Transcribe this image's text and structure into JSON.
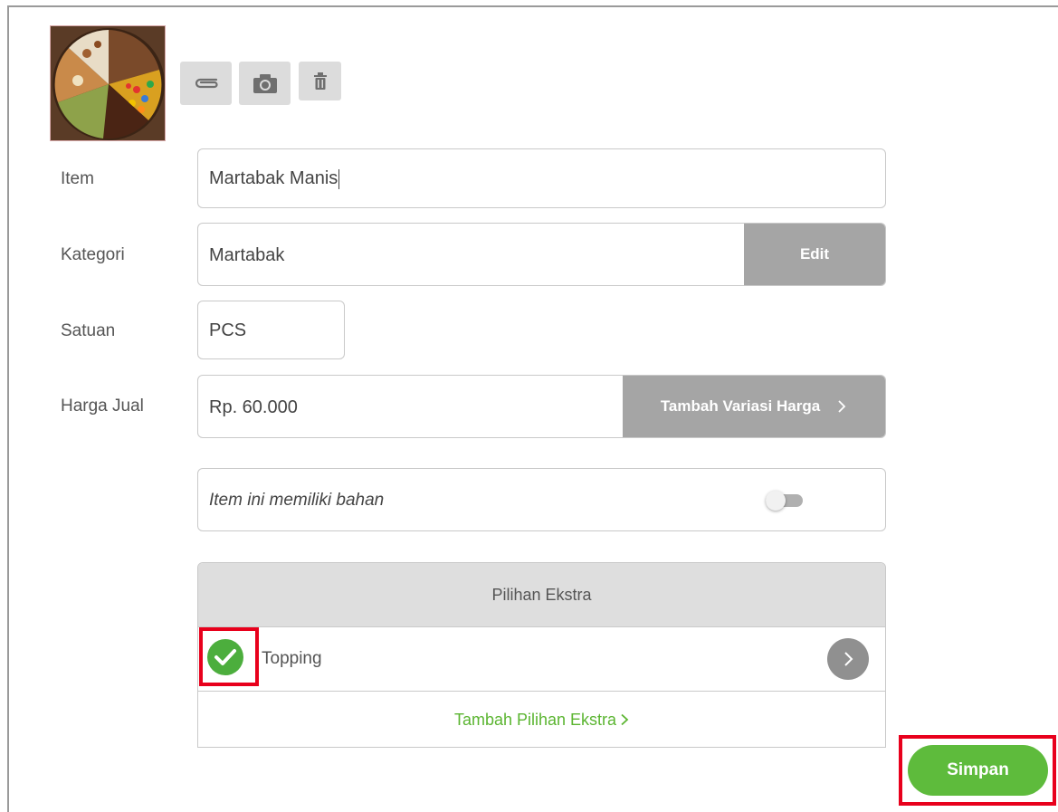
{
  "toolbar": {
    "attach_icon": "paperclip-icon",
    "camera_icon": "camera-icon",
    "delete_icon": "trash-icon"
  },
  "form": {
    "item": {
      "label": "Item",
      "value": "Martabak Manis"
    },
    "kategori": {
      "label": "Kategori",
      "value": "Martabak",
      "button": "Edit"
    },
    "satuan": {
      "label": "Satuan",
      "value": "PCS"
    },
    "harga": {
      "label": "Harga Jual",
      "value": "Rp. 60.000",
      "button": "Tambah Variasi Harga"
    },
    "bahan": {
      "text": "Item ini memiliki bahan",
      "enabled": false
    }
  },
  "extras": {
    "title": "Pilihan Ekstra",
    "items": [
      {
        "name": "Topping",
        "checked": true
      }
    ],
    "add_label": "Tambah Pilihan Ekstra"
  },
  "save_label": "Simpan",
  "colors": {
    "accent_green": "#5ebb3c",
    "check_green": "#4cae3d",
    "link_green": "#5bb531",
    "button_grey": "#a5a5a5",
    "highlight_red": "#e8001c"
  }
}
